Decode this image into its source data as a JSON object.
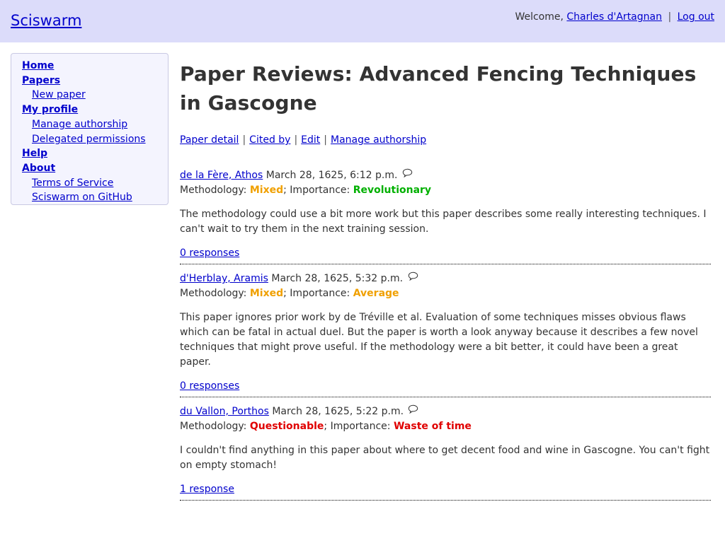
{
  "header": {
    "site_name": "Sciswarm",
    "welcome_text": "Welcome,",
    "user_name": "Charles d'Artagnan",
    "separator": "|",
    "logout": "Log out"
  },
  "sidebar": {
    "items": [
      {
        "label": "Home",
        "level": 0
      },
      {
        "label": "Papers",
        "level": 0
      },
      {
        "label": "New paper",
        "level": 1
      },
      {
        "label": "My profile",
        "level": 0
      },
      {
        "label": "Manage authorship",
        "level": 1
      },
      {
        "label": "Delegated permissions",
        "level": 1
      },
      {
        "label": "Help",
        "level": 0
      },
      {
        "label": "About",
        "level": 0
      },
      {
        "label": "Terms of Service",
        "level": 1
      },
      {
        "label": "Sciswarm on GitHub",
        "level": 1
      }
    ]
  },
  "page": {
    "title": "Paper Reviews: Advanced Fencing Techniques in Gascogne",
    "subnav": [
      "Paper detail",
      "Cited by",
      "Edit",
      "Manage authorship"
    ],
    "separator": "|"
  },
  "labels": {
    "methodology": "Methodology:",
    "importance": "; Importance:"
  },
  "colors": {
    "mixed": "#f0a000",
    "average": "#f0a000",
    "revolutionary": "#00b000",
    "questionable": "#e00000",
    "waste": "#e00000"
  },
  "reviews": [
    {
      "author": "de la Fère, Athos",
      "date": "March 28, 1625, 6:12 p.m.",
      "methodology": "Mixed",
      "methodology_color": "#f0a000",
      "importance": "Revolutionary",
      "importance_color": "#00b000",
      "text": "The methodology could use a bit more work but this paper describes some really interesting techniques. I can't wait to try them in the next training session.",
      "responses": "0 responses"
    },
    {
      "author": "d'Herblay, Aramis",
      "date": "March 28, 1625, 5:32 p.m.",
      "methodology": "Mixed",
      "methodology_color": "#f0a000",
      "importance": "Average",
      "importance_color": "#f0a000",
      "text": "This paper ignores prior work by de Tréville et al. Evaluation of some techniques misses obvious flaws which can be fatal in actual duel. But the paper is worth a look anyway because it describes a few novel techniques that might prove useful. If the methodology were a bit better, it could have been a great paper.",
      "responses": "0 responses"
    },
    {
      "author": "du Vallon, Porthos",
      "date": "March 28, 1625, 5:22 p.m.",
      "methodology": "Questionable",
      "methodology_color": "#e00000",
      "importance": "Waste of time",
      "importance_color": "#e00000",
      "text": "I couldn't find anything in this paper about where to get decent food and wine in Gascogne. You can't fight on empty stomach!",
      "responses": "1 response"
    }
  ]
}
